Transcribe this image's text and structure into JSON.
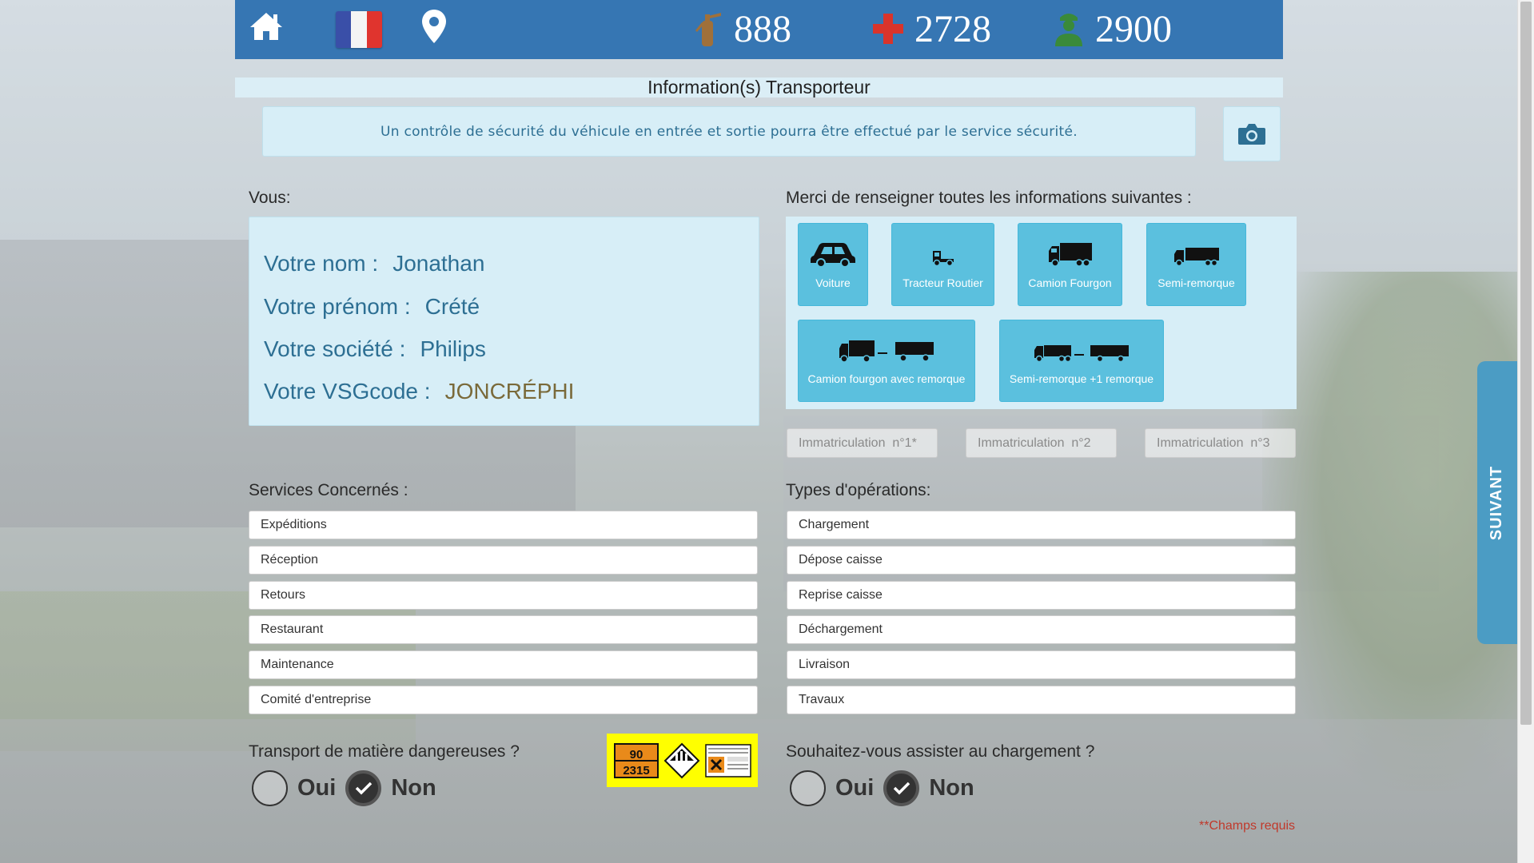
{
  "header": {
    "extinguisher_count": "888",
    "firstaid_count": "2728",
    "guard_count": "2900",
    "bar_color": "#3676b3"
  },
  "title": "Information(s) Transporteur",
  "notice": "Un contrôle de sécurité du véhicule en entrée et sortie pourra être effectué par le service sécurité.",
  "you": {
    "section_label": "Vous:",
    "name_label": "Votre nom :",
    "name_value": "Jonathan",
    "firstname_label": "Votre prénom :",
    "firstname_value": "Crété",
    "company_label": "Votre société :",
    "company_value": "Philips",
    "code_label": "Votre VSGcode :",
    "code_value": "JONCRÉPHI"
  },
  "vehicles": {
    "section_label": "Merci de renseigner toutes les informations suivantes :",
    "options": [
      "Voiture",
      "Tracteur Routier",
      "Camion Fourgon",
      "Semi-remorque",
      "Camion fourgon avec remorque",
      "Semi-remorque +1 remorque"
    ],
    "accent_color": "#5bc0de"
  },
  "plates": {
    "placeholder_1": "Immatriculation  n°1*",
    "placeholder_2": "Immatriculation  n°2",
    "placeholder_3": "Immatriculation  n°3"
  },
  "services": {
    "section_label": "Services Concernés :",
    "items": [
      "Expéditions",
      "Réception",
      "Retours",
      "Restaurant",
      "Maintenance",
      "Comité d'entreprise"
    ]
  },
  "operations": {
    "section_label": "Types d'opérations:",
    "items": [
      "Chargement",
      "Dépose caisse",
      "Reprise caisse",
      "Déchargement",
      "Livraison",
      "Travaux"
    ]
  },
  "hazmat": {
    "question": "Transport de matière dangereuses ?",
    "yes": "Oui",
    "no": "Non",
    "selected": "Non",
    "plate_top": "90",
    "plate_bottom": "2315"
  },
  "assist": {
    "question": "Souhaitez-vous assister au chargement ?",
    "yes": "Oui",
    "no": "Non",
    "selected": "Non"
  },
  "required_note": "**Champs requis",
  "next_label": "SUIVANT"
}
